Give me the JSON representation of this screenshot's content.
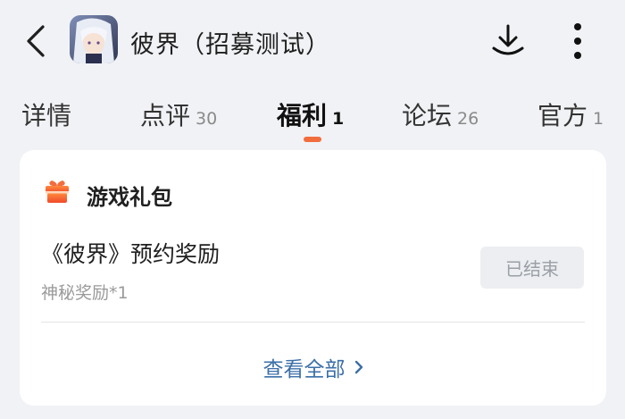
{
  "header": {
    "title": "彼界（招募测试）",
    "icons": {
      "back": "back-arrow-icon",
      "download": "download-icon",
      "more": "more-vertical-icon"
    }
  },
  "tabs": [
    {
      "label": "详情",
      "count": ""
    },
    {
      "label": "点评",
      "count": "30"
    },
    {
      "label": "福利",
      "count": "1",
      "active": true
    },
    {
      "label": "论坛",
      "count": "26"
    },
    {
      "label": "官方",
      "count": "1"
    }
  ],
  "colors": {
    "accent": "#f26d3d",
    "link": "#3b6fa8",
    "background": "#f1f2f5"
  },
  "gift_section": {
    "title": "游戏礼包",
    "icon": "gift-icon",
    "item": {
      "title": "《彼界》预约奖励",
      "subtitle": "神秘奖励*1",
      "status": "已结束"
    },
    "view_all": "查看全部"
  }
}
